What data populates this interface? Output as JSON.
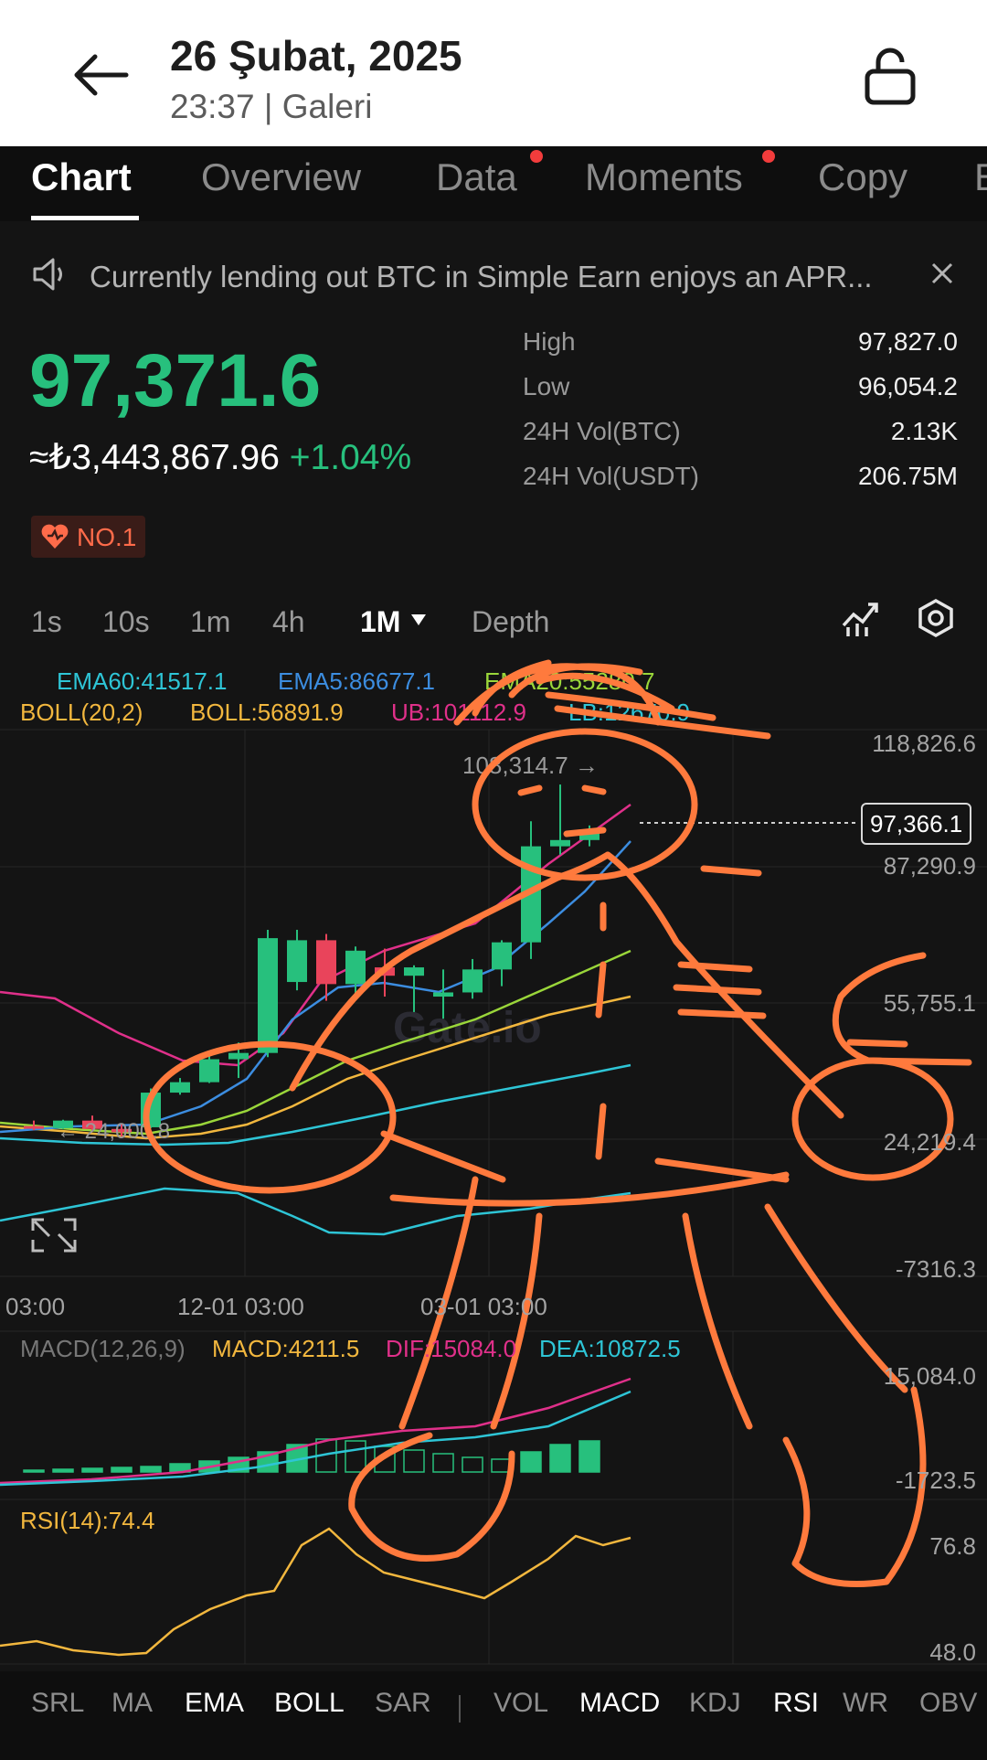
{
  "header": {
    "date": "26 Şubat, 2025",
    "subtitle": "23:37 | Galeri"
  },
  "tabs": [
    {
      "label": "Chart",
      "active": true
    },
    {
      "label": "Overview"
    },
    {
      "label": "Data",
      "dot": true
    },
    {
      "label": "Moments",
      "dot": true
    },
    {
      "label": "Copy"
    },
    {
      "label": "E"
    }
  ],
  "notice": {
    "text": "Currently lending out BTC in Simple Earn enjoys an APR..."
  },
  "ticker": {
    "price": "97,371.6",
    "local_price": "≈₺3,443,867.96",
    "change": "+1.04%",
    "badge": "NO.1",
    "stats": [
      {
        "label": "High",
        "value": "97,827.0"
      },
      {
        "label": "Low",
        "value": "96,054.2"
      },
      {
        "label": "24H Vol(BTC)",
        "value": "2.13K"
      },
      {
        "label": "24H Vol(USDT)",
        "value": "206.75M"
      }
    ]
  },
  "timeframes": [
    "1s",
    "10s",
    "1m",
    "4h",
    "1M",
    "Depth"
  ],
  "timeframe_active": "1M",
  "indicators_top": {
    "ema60": "EMA60:41517.1",
    "ema5": "EMA5:86677.1",
    "ema20": "EMA20:55280.7",
    "boll": "BOLL(20,2)",
    "boll_val": "BOLL:56891.9",
    "ub": "UB:101112.9",
    "lb": "LB:12670.9"
  },
  "chart_data": {
    "type": "candlestick",
    "y_axis": [
      "118,826.6",
      "87,290.9",
      "55,755.1",
      "24,219.4",
      "-7316.3"
    ],
    "x_axis": [
      "03:00",
      "12-01 03:00",
      "03-01 03:00"
    ],
    "last_price_label": "97,366.1",
    "high_marker": "108,314.7 →",
    "low_marker": "← 24,000.8",
    "candles": [
      {
        "o": 26500,
        "h": 27800,
        "l": 25500,
        "c": 26000
      },
      {
        "o": 26000,
        "h": 28000,
        "l": 25800,
        "c": 27800
      },
      {
        "o": 27800,
        "h": 29000,
        "l": 25200,
        "c": 25800
      },
      {
        "o": 25800,
        "h": 27000,
        "l": 24000,
        "c": 25000
      },
      {
        "o": 26200,
        "h": 35500,
        "l": 26000,
        "c": 34500
      },
      {
        "o": 34500,
        "h": 38000,
        "l": 34000,
        "c": 37000
      },
      {
        "o": 37000,
        "h": 44000,
        "l": 36800,
        "c": 42500
      },
      {
        "o": 42500,
        "h": 46500,
        "l": 38000,
        "c": 44000
      },
      {
        "o": 44000,
        "h": 73500,
        "l": 43000,
        "c": 71500
      },
      {
        "o": 61000,
        "h": 73500,
        "l": 59000,
        "c": 71000
      },
      {
        "o": 71000,
        "h": 72500,
        "l": 56500,
        "c": 60500
      },
      {
        "o": 60500,
        "h": 69500,
        "l": 58000,
        "c": 68500
      },
      {
        "o": 64500,
        "h": 69000,
        "l": 57500,
        "c": 62500
      },
      {
        "o": 62500,
        "h": 65000,
        "l": 53800,
        "c": 64500
      },
      {
        "o": 57500,
        "h": 64000,
        "l": 52200,
        "c": 58500
      },
      {
        "o": 58500,
        "h": 66500,
        "l": 57000,
        "c": 64000
      },
      {
        "o": 64000,
        "h": 71000,
        "l": 60000,
        "c": 70500
      },
      {
        "o": 70500,
        "h": 99500,
        "l": 66500,
        "c": 93500
      },
      {
        "o": 93500,
        "h": 108300,
        "l": 91500,
        "c": 95000
      },
      {
        "o": 95000,
        "h": 98500,
        "l": 93500,
        "c": 97366
      }
    ]
  },
  "macd": {
    "title": "MACD(12,26,9)",
    "macd": "MACD:4211.5",
    "dif": "DIF:15084.0",
    "dea": "DEA:10872.5",
    "axis_top": "15,084.0",
    "axis_bottom": "-1723.5"
  },
  "rsi": {
    "title": "RSI(14):74.4",
    "axis_top": "76.8",
    "axis_bottom": "48.0"
  },
  "bottom_indicators": [
    {
      "label": "SRL"
    },
    {
      "label": "MA"
    },
    {
      "label": "EMA",
      "on": true
    },
    {
      "label": "BOLL",
      "on": true
    },
    {
      "label": "SAR"
    },
    {
      "label": "VOL"
    },
    {
      "label": "MACD",
      "on": true
    },
    {
      "label": "KDJ"
    },
    {
      "label": "RSI",
      "on": true
    },
    {
      "label": "WR"
    },
    {
      "label": "OBV"
    }
  ],
  "watermark": "Gate.io",
  "colors": {
    "up": "#27c07d",
    "down": "#e9445b",
    "doodle": "#ff7a3d",
    "ema60": "#2ec5d6",
    "ema5": "#3c8de0",
    "ema20": "#9ad63a",
    "boll": "#f2b73e",
    "ub": "#e0308a"
  }
}
